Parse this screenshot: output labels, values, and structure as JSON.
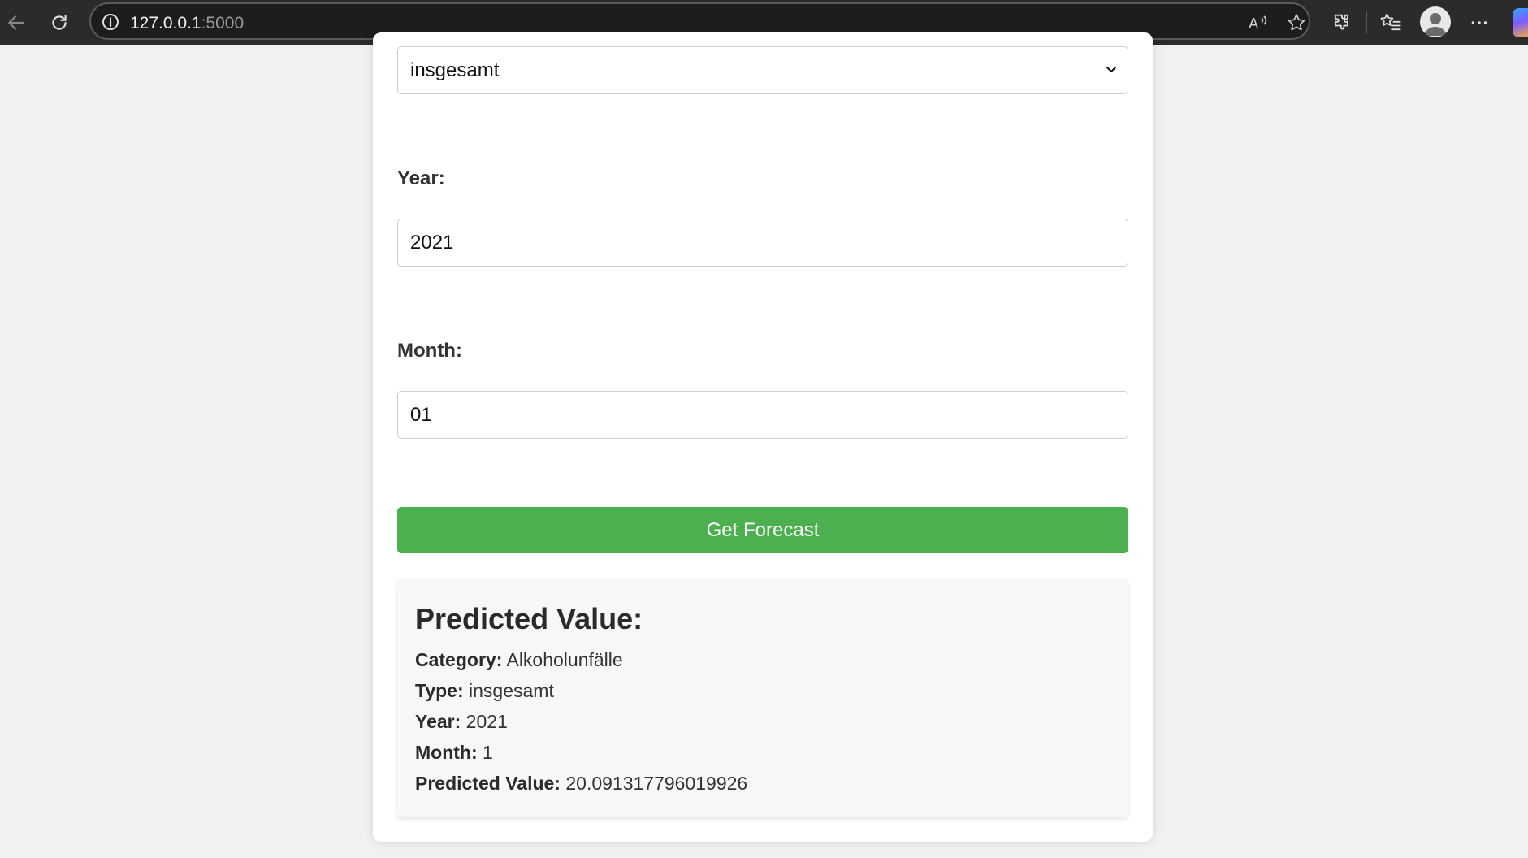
{
  "browser": {
    "url_host": "127.0.0.1",
    "url_port": ":5000"
  },
  "form": {
    "type_select_value": "insgesamt",
    "year_label": "Year:",
    "year_value": "2021",
    "month_label": "Month:",
    "month_value": "01",
    "submit_label": "Get Forecast"
  },
  "result": {
    "heading": "Predicted Value:",
    "category_label": "Category:",
    "category_value": "Alkoholunfälle",
    "type_label": "Type:",
    "type_value": "insgesamt",
    "year_label": "Year:",
    "year_value": "2021",
    "month_label": "Month:",
    "month_value": "1",
    "predicted_label": "Predicted Value:",
    "predicted_value": "20.091317796019926"
  },
  "colors": {
    "accent_button": "#4caf50",
    "toolbar_bg": "#2b2b2b"
  }
}
